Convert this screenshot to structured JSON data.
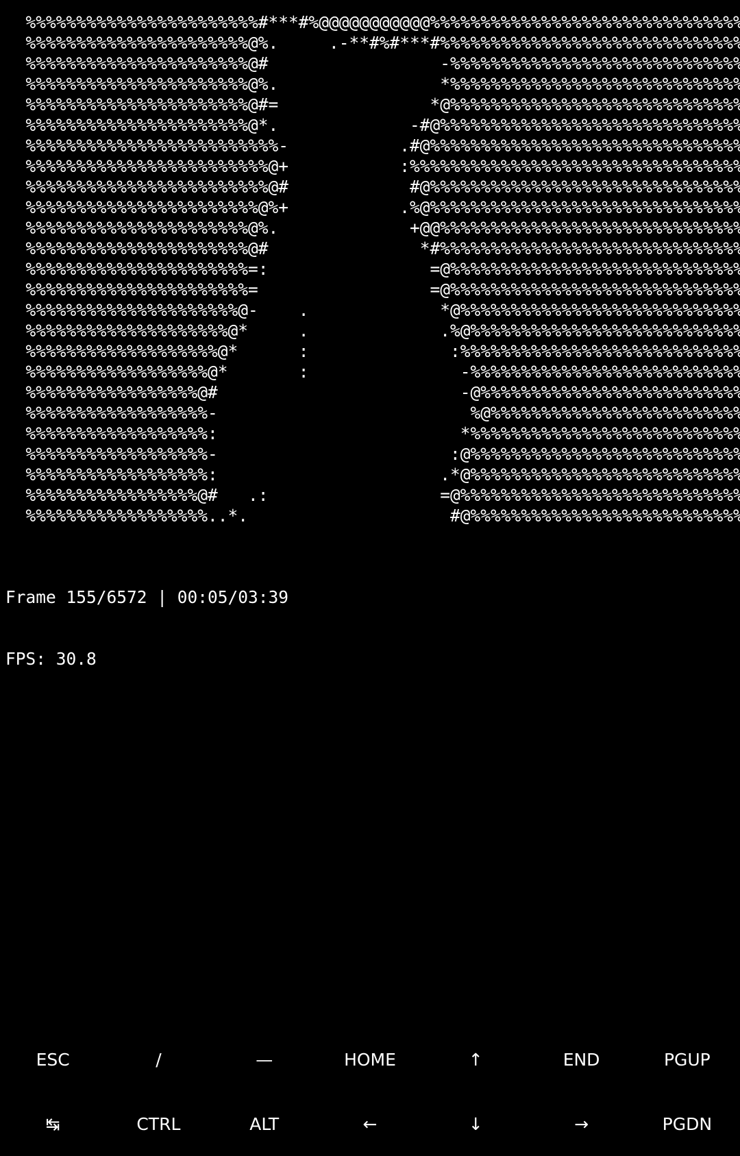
{
  "terminal": {
    "ascii_lines": [
      "  %%%%%%%%%%%%%%%%%%%%%%%#***#%@@@@@@@@@@@%%%%%%%%%%%%%%%%%%%%%%%%%%%%%%%",
      "  %%%%%%%%%%%%%%%%%%%%%%@%.     .-**#%#***#%%%%%%%%%%%%%%%%%%%%%%%%%%%%%%%",
      "  %%%%%%%%%%%%%%%%%%%%%%@#                 -%%%%%%%%%%%%%%%%%%%%%%%%%%%%%%",
      "  %%%%%%%%%%%%%%%%%%%%%%@%.                *%%%%%%%%%%%%%%%%%%%%%%%%%%%%%%",
      "  %%%%%%%%%%%%%%%%%%%%%%@#=               *@%%%%%%%%%%%%%%%%%%%%%%%%%%%%%%",
      "  %%%%%%%%%%%%%%%%%%%%%%@*.             -#@%%%%%%%%%%%%%%%%%%%%%%%%%%%%%%%",
      "  %%%%%%%%%%%%%%%%%%%%%%%%%-           .#@%%%%%%%%%%%%%%%%%%%%%%%%%%%%%%%",
      "  %%%%%%%%%%%%%%%%%%%%%%%%@+           :%%%%%%%%%%%%%%%%%%%%%%%%%%%%%%%%%%",
      "  %%%%%%%%%%%%%%%%%%%%%%%%@#            #@%%%%%%%%%%%%%%%%%%%%%%%%%%%%%%%%",
      "  %%%%%%%%%%%%%%%%%%%%%%%@%+           .%@%%%%%%%%%%%%%%%%%%%%%%%%%%%%%%%%",
      "  %%%%%%%%%%%%%%%%%%%%%%@%.             +@@%%%%%%%%%%%%%%%%%%%%%%%%%%%%%%%",
      "  %%%%%%%%%%%%%%%%%%%%%%@#               *#%%%%%%%%%%%%%%%%%%%%%%%%%%%%%%%",
      "  %%%%%%%%%%%%%%%%%%%%%%=:                =@%%%%%%%%%%%%%%%%%%%%%%%%%%%%%%",
      "  %%%%%%%%%%%%%%%%%%%%%%=                 =@%%%%%%%%%%%%%%%%%%%%%%%%%%%%%%",
      "  %%%%%%%%%%%%%%%%%%%%%@-    .             *@%%%%%%%%%%%%%%%%%%%%%%%%%%%%%",
      "  %%%%%%%%%%%%%%%%%%%%@*     .             .%@%%%%%%%%%%%%%%%%%%%%%%%%%%%%",
      "  %%%%%%%%%%%%%%%%%%%@*      :              :%%%%%%%%%%%%%%%%%%%%%%%%%%%%%",
      "  %%%%%%%%%%%%%%%%%%@*       :               -%%%%%%%%%%%%%%%%%%%%%%%%%%%%",
      "  %%%%%%%%%%%%%%%%%@#                        -@%%%%%%%%%%%%%%%%%%%%%%%%%%%",
      "  %%%%%%%%%%%%%%%%%%-                         %@%%%%%%%%%%%%%%%%%%%%%%%%%%",
      "  %%%%%%%%%%%%%%%%%%:                        *%%%%%%%%%%%%%%%%%%%%%%%%%%%%",
      "  %%%%%%%%%%%%%%%%%%-                       :@%%%%%%%%%%%%%%%%%%%%%%%%%%%%",
      "  %%%%%%%%%%%%%%%%%%:                      .*@%%%%%%%%%%%%%%%%%%%%%%%%%%%%",
      "  %%%%%%%%%%%%%%%%%@#   .:                 =@%%%%%%%%%%%%%%%%%%%%%%%%%%%%%",
      "  %%%%%%%%%%%%%%%%%%..*.                    #@%%%%%%%%%%%%%%%%%%%%%%%%%%%%"
    ],
    "frame_status": "Frame 155/6572 | 00:05/03:39",
    "fps_status": "FPS: 30.8"
  },
  "extra_keys": {
    "row1": [
      "ESC",
      "/",
      "—",
      "HOME",
      "↑",
      "END",
      "PGUP"
    ],
    "row2": [
      "↹",
      "CTRL",
      "ALT",
      "←",
      "↓",
      "→",
      "PGDN"
    ]
  },
  "colors": {
    "background": "#000000",
    "text": "#ffffff"
  }
}
